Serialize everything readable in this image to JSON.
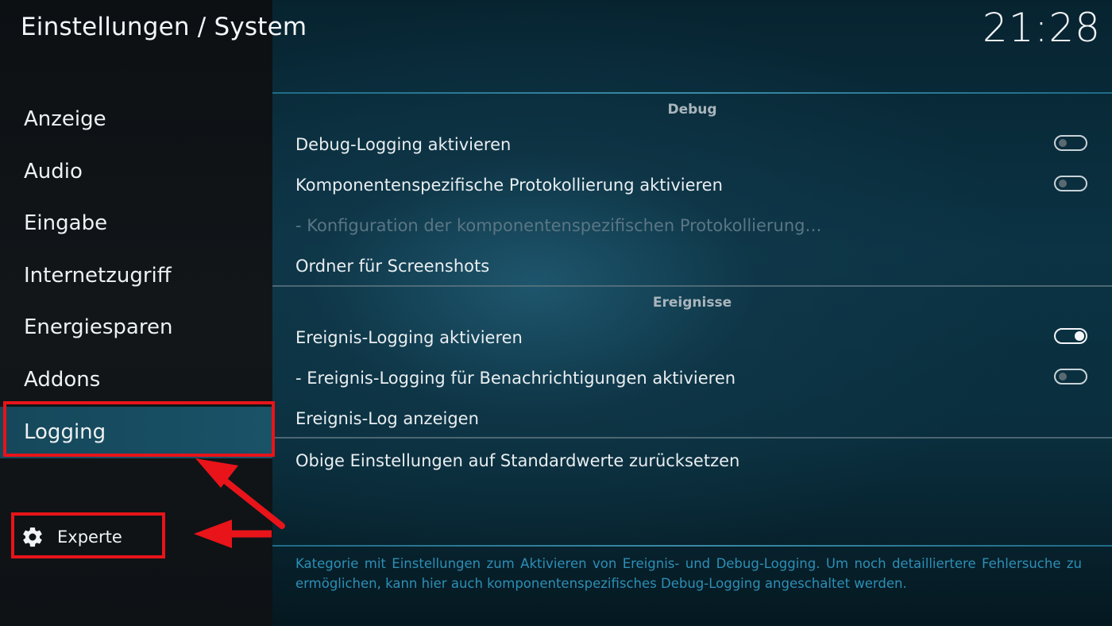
{
  "header": {
    "title": "Einstellungen / System",
    "clock": "21:28"
  },
  "sidebar": {
    "items": [
      {
        "label": "Anzeige"
      },
      {
        "label": "Audio"
      },
      {
        "label": "Eingabe"
      },
      {
        "label": "Internetzugriff"
      },
      {
        "label": "Energiesparen"
      },
      {
        "label": "Addons"
      },
      {
        "label": "Logging",
        "active": true
      }
    ],
    "level_button": {
      "label": "Experte",
      "icon": "gear-icon"
    }
  },
  "sections": {
    "debug": {
      "header": "Debug",
      "rows": [
        {
          "label": "Debug-Logging aktivieren",
          "toggle": "off"
        },
        {
          "label": "Komponentenspezifische Protokollierung aktivieren",
          "toggle": "off"
        },
        {
          "label": "- Konfiguration der komponentenspezifischen Protokollierung…",
          "disabled": true
        },
        {
          "label": "Ordner für Screenshots"
        }
      ]
    },
    "events": {
      "header": "Ereignisse",
      "rows": [
        {
          "label": "Ereignis-Logging aktivieren",
          "toggle": "on"
        },
        {
          "label": "- Ereignis-Logging für Benachrichtigungen aktivieren",
          "toggle": "off"
        },
        {
          "label": "Ereignis-Log anzeigen"
        }
      ]
    },
    "reset": {
      "label": "Obige Einstellungen auf Standardwerte zurücksetzen"
    }
  },
  "description": "Kategorie mit Einstellungen zum Aktivieren von Ereignis- und Debug-Logging. Um noch detailliertere Fehlersuche zu ermöglichen, kann hier auch komponentenspezifisches Debug-Logging angeschaltet werden.",
  "colors": {
    "accent": "#1a5267",
    "annotation": "#e8141a",
    "description_text": "#2d8fb6"
  }
}
